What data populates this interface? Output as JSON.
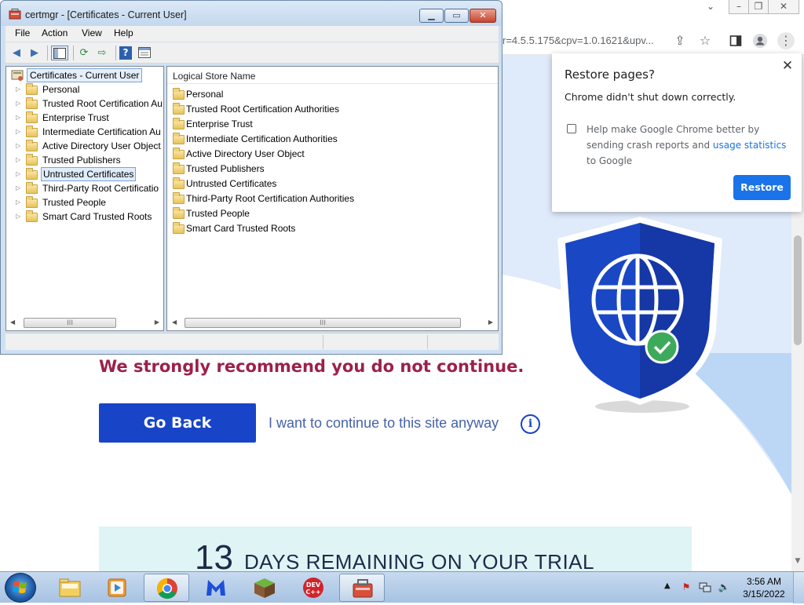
{
  "browser": {
    "omnibox_fragment": "r=4.5.5.175&cpv=1.0.1621&upv...",
    "icons": [
      "share-icon",
      "star-icon",
      "sidebar-icon",
      "profile-icon",
      "menu-icon"
    ]
  },
  "page": {
    "warning": "We strongly recommend you do not continue.",
    "go_back_label": "Go Back",
    "continue_link": "I want to continue to this site anyway",
    "info_glyph": "i",
    "trial_number": "13",
    "trial_text": "DAYS REMAINING ON YOUR TRIAL"
  },
  "restore_popup": {
    "title": "Restore pages?",
    "message": "Chrome didn't shut down correctly.",
    "help_text_before": "Help make Google Chrome better by sending crash reports and ",
    "help_link": "usage statistics",
    "help_text_after": " to Google",
    "checkbox_checked": false,
    "button_label": "Restore"
  },
  "certmgr": {
    "title": "certmgr - [Certificates - Current User]",
    "menu": [
      "File",
      "Action",
      "View",
      "Help"
    ],
    "tree_root": "Certificates - Current User",
    "tree_items": [
      "Personal",
      "Trusted Root Certification Au",
      "Enterprise Trust",
      "Intermediate Certification Au",
      "Active Directory User Object",
      "Trusted Publishers",
      "Untrusted Certificates",
      "Third-Party Root Certificatio",
      "Trusted People",
      "Smart Card Trusted Roots"
    ],
    "selected_tree_item": "Untrusted Certificates",
    "column_header": "Logical Store Name",
    "stores": [
      "Personal",
      "Trusted Root Certification Authorities",
      "Enterprise Trust",
      "Intermediate Certification Authorities",
      "Active Directory User Object",
      "Trusted Publishers",
      "Untrusted Certificates",
      "Third-Party Root Certification Authorities",
      "Trusted People",
      "Smart Card Trusted Roots"
    ]
  },
  "taskbar": {
    "apps": [
      "explorer-icon",
      "media-player-icon",
      "chrome-icon",
      "malwarebytes-icon",
      "minecraft-icon",
      "devcpp-icon",
      "certmgr-icon"
    ],
    "active_app": "certmgr-icon",
    "time": "3:56 AM",
    "date": "3/15/2022"
  },
  "colors": {
    "warning": "#9c2148",
    "go_back": "#1844c8",
    "restore_button": "#1a73e8",
    "shield": "#1a47c4",
    "check_badge": "#3daa5b"
  }
}
